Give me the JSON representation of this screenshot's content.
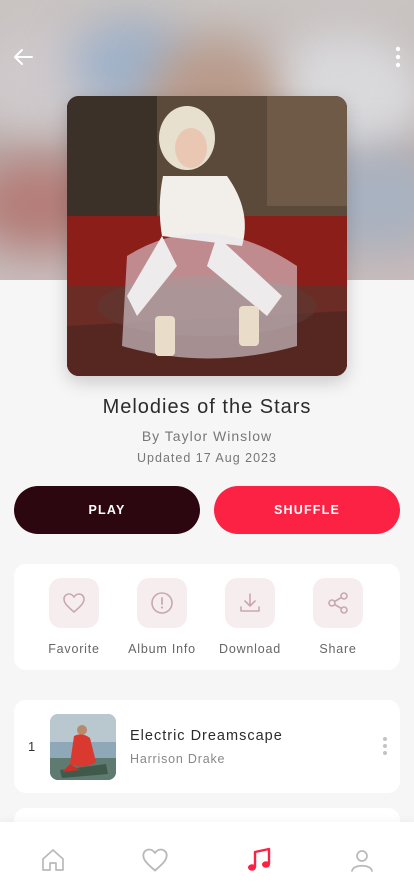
{
  "album": {
    "title": "Melodies of the Stars",
    "artist": "By Taylor Winslow",
    "updated": "Updated 17 Aug 2023"
  },
  "header": {
    "back_icon": "arrow-left-icon",
    "more_icon": "more-vertical-icon"
  },
  "buttons": {
    "play_label": "PLAY",
    "shuffle_label": "SHUFFLE"
  },
  "actions": [
    {
      "label": "Favorite",
      "icon": "heart-icon"
    },
    {
      "label": "Album Info",
      "icon": "info-icon"
    },
    {
      "label": "Download",
      "icon": "download-icon"
    },
    {
      "label": "Share",
      "icon": "share-icon"
    }
  ],
  "tracks": [
    {
      "number": "1",
      "title": "Electric Dreamscape",
      "artist": "Harrison Drake"
    }
  ],
  "bottom_nav": [
    {
      "icon": "home-icon",
      "active": false
    },
    {
      "icon": "heart-icon",
      "active": false
    },
    {
      "icon": "music-note-icon",
      "active": true
    },
    {
      "icon": "profile-icon",
      "active": false
    }
  ],
  "colors": {
    "accent": "#fb2243",
    "play_button": "#2d0710",
    "action_icon": "#c9a8ad",
    "nav_inactive": "#b9b9b9"
  }
}
